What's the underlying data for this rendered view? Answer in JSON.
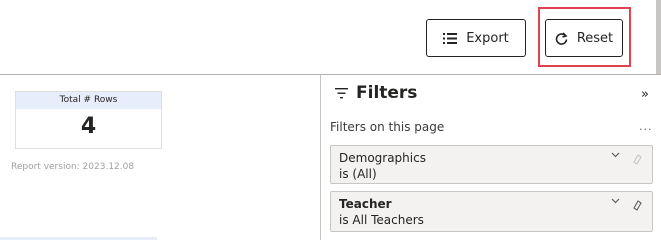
{
  "toolbar": {
    "export_label": "Export",
    "reset_label": "Reset",
    "highlight_color": "#e0434f"
  },
  "card": {
    "title": "Total # Rows",
    "value": "4"
  },
  "report_version": "Report version: 2023.12.08",
  "filters": {
    "title": "Filters",
    "section_label": "Filters on this page",
    "more_label": "...",
    "items": [
      {
        "name": "Demographics",
        "value": "is (All)",
        "bold": false
      },
      {
        "name": "Teacher",
        "value": "is All Teachers",
        "bold": true
      }
    ]
  },
  "icons": {
    "export": "list-icon",
    "reset": "refresh-icon",
    "filter": "filter-icon",
    "collapse": "double-chevron-right-icon",
    "expand": "chevron-down-icon",
    "clear": "eraser-icon"
  }
}
